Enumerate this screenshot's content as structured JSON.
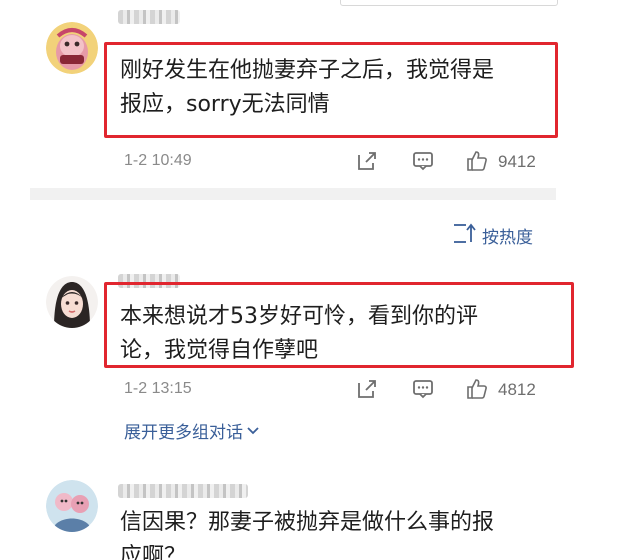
{
  "comments": [
    {
      "text_line1": "刚好发生在他抛妻弃子之后，我觉得是",
      "text_line2": "报应，sorry无法同情",
      "timestamp": "1-2 10:49",
      "like_count": "9412"
    },
    {
      "text_line1": "本来想说才53岁好可怜，看到你的评",
      "text_line2": "论，我觉得自作孽吧",
      "timestamp": "1-2 13:15",
      "like_count": "4812"
    },
    {
      "text_line1": "信因果？那妻子被抛弃是做什么事的报",
      "text_line2": "应啊？"
    }
  ],
  "sort": {
    "label": "按热度"
  },
  "expand": {
    "label": "展开更多组对话"
  },
  "colors": {
    "highlight": "#e1262f",
    "link": "#3a5f99",
    "meta": "#8a8a8a"
  },
  "icons": {
    "share": "share-icon",
    "reply": "comment-icon",
    "like": "thumbs-up-icon",
    "sort": "sort-icon",
    "chevron": "chevron-down-icon"
  }
}
